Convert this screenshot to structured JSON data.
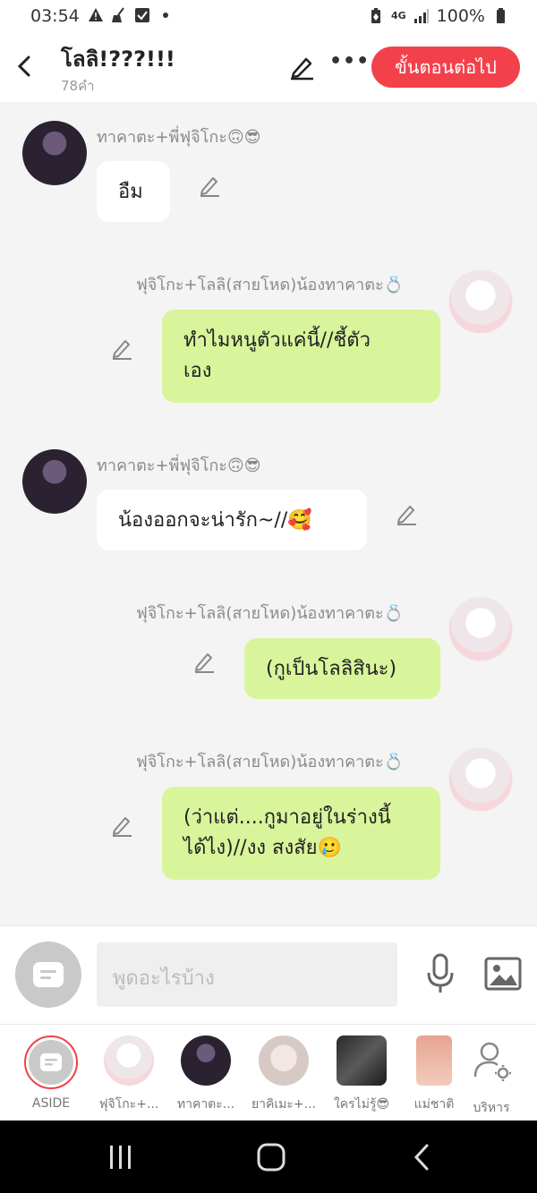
{
  "status_bar": {
    "time": "03:54",
    "network": "4G",
    "battery": "100%"
  },
  "header": {
    "title": "โลลิ!???!!!",
    "subtitle": "78คำ",
    "next_button": "ขั้นตอนต่อไป"
  },
  "messages": [
    {
      "sender": "ทาคาตะ+พี่ฟุจิโกะ🙃😎",
      "text": "อืม"
    },
    {
      "sender": "ฟุจิโกะ+โลลิ(สายโหด)น้องทาคาตะ💍",
      "line1": "ทำไมหนูตัวแค่นี้//ชี้ตัว",
      "line2": "เอง"
    },
    {
      "sender": "ทาคาตะ+พี่ฟุจิโกะ🙃😎",
      "text": "น้องออกจะน่ารัก~//🥰"
    },
    {
      "sender": "ฟุจิโกะ+โลลิ(สายโหด)น้องทาคาตะ💍",
      "text": "(กูเป็นโลลิสินะ)"
    },
    {
      "sender": "ฟุจิโกะ+โลลิ(สายโหด)น้องทาคาตะ💍",
      "line1": "(ว่าแต่....กูมาอยู่ในร่างนี้",
      "line2": "ได้ไง)//งง สงสัย🥲"
    }
  ],
  "composer": {
    "placeholder": "พูดอะไรบ้าง"
  },
  "characters": [
    {
      "label": "ASIDE"
    },
    {
      "label": "ฟุจิโกะ+..."
    },
    {
      "label": "ทาคาตะ..."
    },
    {
      "label": "ยาคิเมะ+..."
    },
    {
      "label": "ใครไม่รู้😎"
    },
    {
      "label": "แม่ชาติ"
    },
    {
      "label": "บริหาร"
    }
  ],
  "colors": {
    "accent": "#f3414b",
    "bubble_green": "#d9f59b",
    "bubble_white": "#ffffff",
    "background": "#f4f4f4"
  }
}
